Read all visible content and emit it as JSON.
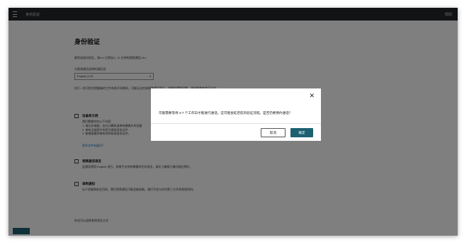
{
  "header": {
    "app_title": "身份验证",
    "help_label": "帮助"
  },
  "page": {
    "heading": "身份验证",
    "intro": "要完成身份验证，请<b>立即加入 10 分钟的视频通话</b>",
    "language_label": "为视频通话选择的通话语：",
    "language_value": "English (US)",
    "note": "由于一些可信任提醒者的工作系统不同期间，可能无法完成视频通话验证。如果你遇到问题，请选择其他验证方式。",
    "options": [
      {
        "title": "设备和文档",
        "desc": "我们需要你在以下内容：\n1. 笔记本电脑，台式计算机或带有摄像头的设备\n2. 带有当前照片的官方颁发身份证件\n3. 能够查看的带有你的有效身份证件。",
        "link": "更多文件有疑问？"
      },
      {
        "title": "视频通话语言",
        "desc": "此通话将用 English 进行。如果不支持你需要的任何语言，请学上确保已做好相应预约。"
      },
      {
        "title": "录制通知",
        "desc": "出于质量和安全目的，我们视频通话可能会被录制。我们不会与任何第三方共享视频资料。"
      }
    ],
    "footer_text": "你也可以选择其他验证方式"
  },
  "dialog": {
    "message": "可能需要等待 2-7 个工作日才能进行通话。这可能会延迟您的验证流程。是否仍要预约通话？",
    "cancel_label": "取消",
    "ok_label": "确定",
    "close_glyph": "✕"
  }
}
